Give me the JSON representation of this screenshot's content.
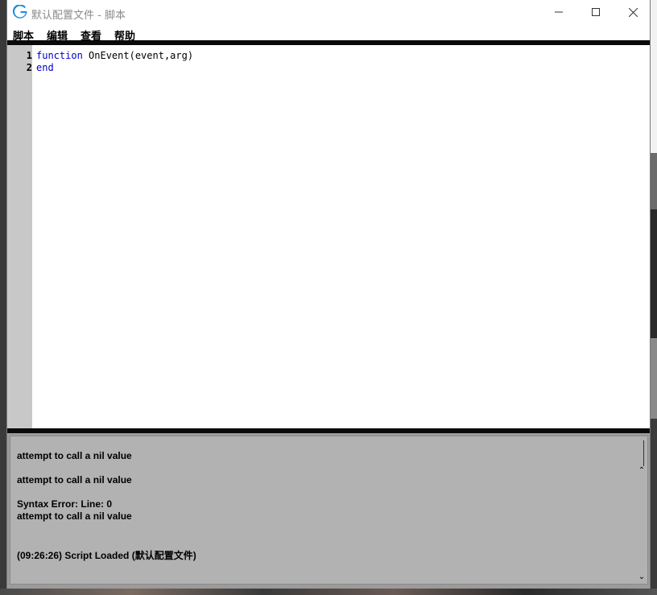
{
  "window": {
    "title": "默认配置文件 - 脚本",
    "icon": "logitech-g-icon",
    "accent": "#1a8cdc"
  },
  "menu": {
    "items": [
      {
        "label": "脚本"
      },
      {
        "label": "编辑"
      },
      {
        "label": "查看"
      },
      {
        "label": "帮助"
      }
    ]
  },
  "editor": {
    "lines": [
      {
        "number": "1",
        "keyword": "function",
        "rest": " OnEvent(event,arg)"
      },
      {
        "number": "2",
        "keyword": "end",
        "rest": ""
      }
    ]
  },
  "output": {
    "messages": [
      "attempt to call a nil value",
      "attempt to call a nil value",
      "Syntax Error: Line: 0",
      "attempt to call a nil value",
      "(09:26:26) Script Loaded (默认配置文件)"
    ]
  }
}
